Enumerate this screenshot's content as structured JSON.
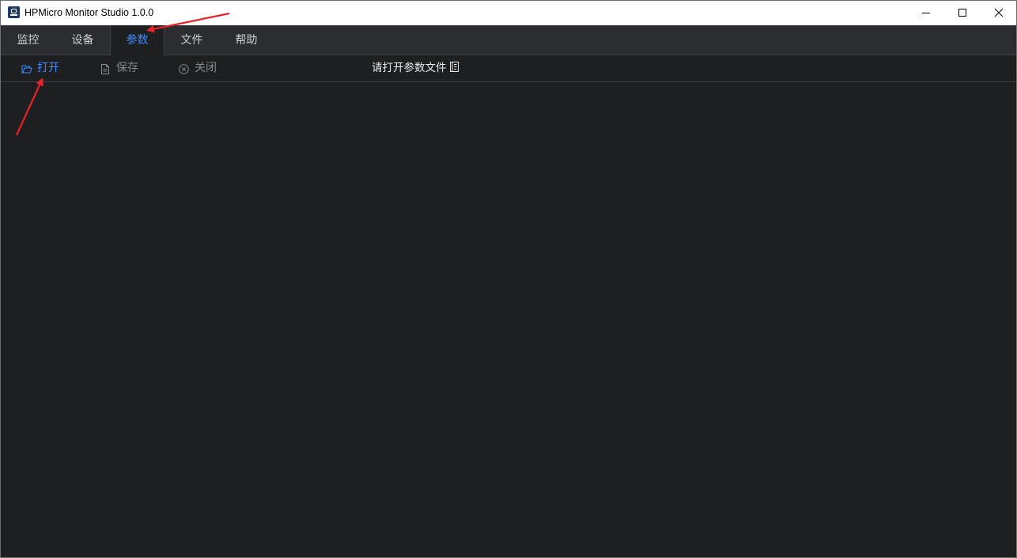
{
  "window": {
    "title": "HPMicro Monitor Studio 1.0.0",
    "icon": "hpmicro-app-icon"
  },
  "tabs": [
    {
      "label": "监控",
      "active": false
    },
    {
      "label": "设备",
      "active": false
    },
    {
      "label": "参数",
      "active": true
    },
    {
      "label": "文件",
      "active": false
    },
    {
      "label": "帮助",
      "active": false
    }
  ],
  "toolbar": {
    "open_label": "打开",
    "save_label": "保存",
    "close_label": "关闭",
    "status_text": "请打开参数文件"
  },
  "colors": {
    "accent": "#3d8bff",
    "background": "#1e1f21",
    "tabbar": "#2b2d30",
    "annotation": "#e8222b"
  },
  "icons": {
    "open": "folder-open-icon",
    "save": "document-icon",
    "close": "circle-x-icon",
    "status": "document-list-icon"
  }
}
